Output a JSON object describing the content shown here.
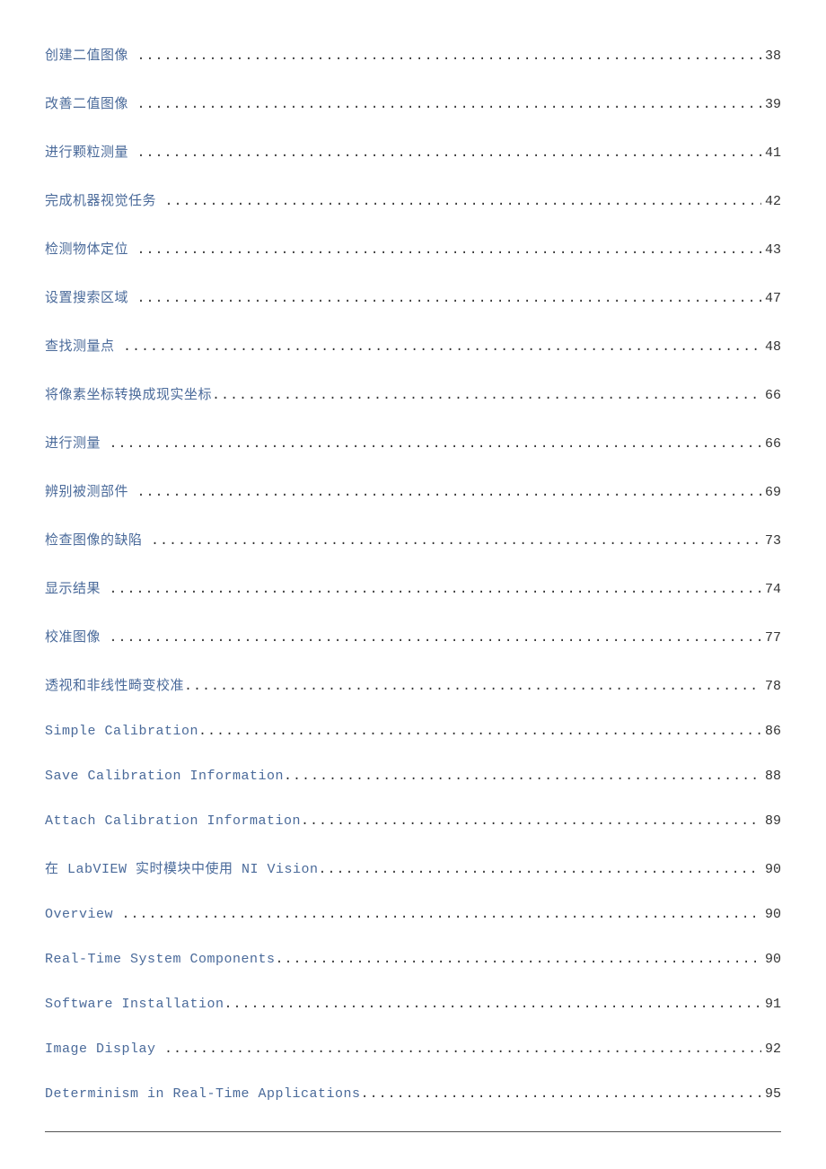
{
  "toc": {
    "entries": [
      {
        "title": "创建二值图像",
        "page": "38",
        "pad": true
      },
      {
        "title": "改善二值图像",
        "page": "39",
        "pad": true
      },
      {
        "title": "进行颗粒测量",
        "page": "41",
        "pad": true
      },
      {
        "title": "完成机器视觉任务",
        "page": "42",
        "pad": true
      },
      {
        "title": "检测物体定位",
        "page": "43",
        "pad": true
      },
      {
        "title": "设置搜索区域",
        "page": "47",
        "pad": true
      },
      {
        "title": "查找测量点",
        "page": "48",
        "pad": true
      },
      {
        "title": "将像素坐标转换成现实坐标",
        "page": "66",
        "pad": false
      },
      {
        "title": "进行测量",
        "page": "66",
        "pad": true
      },
      {
        "title": "辨别被测部件",
        "page": "69",
        "pad": true
      },
      {
        "title": "检查图像的缺陷",
        "page": "73",
        "pad": true
      },
      {
        "title": "显示结果",
        "page": "74",
        "pad": true
      },
      {
        "title": "校准图像",
        "page": "77",
        "pad": true
      },
      {
        "title": "透视和非线性畸变校准",
        "page": "78",
        "pad": false
      },
      {
        "title": "Simple Calibration",
        "page": "86",
        "pad": false
      },
      {
        "title": "Save Calibration Information",
        "page": "88",
        "pad": false
      },
      {
        "title": "Attach Calibration Information",
        "page": "89",
        "pad": false
      },
      {
        "title": "在 LabVIEW 实时模块中使用 NI Vision",
        "page": "90",
        "pad": false
      },
      {
        "title": "Overview",
        "page": "90",
        "pad": true
      },
      {
        "title": "Real-Time System Components",
        "page": "90",
        "pad": false
      },
      {
        "title": "Software Installation",
        "page": "91",
        "pad": false
      },
      {
        "title": "Image Display",
        "page": "92",
        "pad": true
      },
      {
        "title": "Determinism in Real-Time Applications",
        "page": "95",
        "pad": false
      }
    ]
  }
}
